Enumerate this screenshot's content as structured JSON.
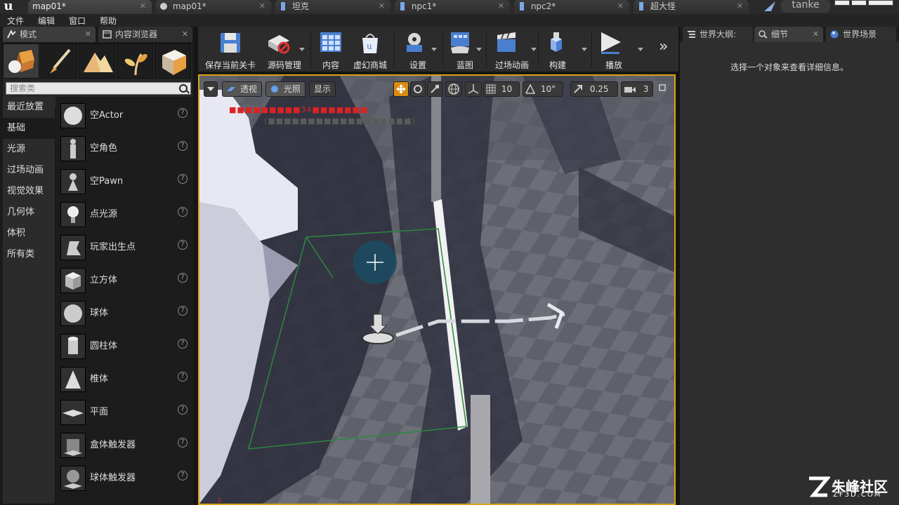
{
  "title_bar": {
    "tabs": [
      {
        "label": "map01*"
      },
      {
        "label": "map01*"
      },
      {
        "label": "坦克"
      },
      {
        "label": "npc1*"
      },
      {
        "label": "npc2*"
      },
      {
        "label": "超大怪"
      }
    ],
    "close_glyph": "✕",
    "project": "tanke"
  },
  "menu": {
    "items": [
      "文件",
      "编辑",
      "窗口",
      "帮助"
    ]
  },
  "left_panel": {
    "tabs": [
      {
        "label": "模式"
      },
      {
        "label": "内容浏览器"
      }
    ],
    "search_placeholder": "搜索类",
    "categories": [
      "最近放置",
      "基础",
      "光源",
      "过场动画",
      "视觉效果",
      "几何体",
      "体积",
      "所有类"
    ],
    "assets": [
      "空Actor",
      "空角色",
      "空Pawn",
      "点光源",
      "玩家出生点",
      "立方体",
      "球体",
      "圆柱体",
      "椎体",
      "平面",
      "盒体触发器",
      "球体触发器"
    ],
    "help_glyph": "?"
  },
  "toolbar": {
    "buttons": [
      "保存当前关卡",
      "源码管理",
      "内容",
      "虚幻商城",
      "设置",
      "蓝图",
      "过场动画",
      "构建",
      "播放"
    ],
    "more_glyph": "»"
  },
  "viewport": {
    "controls": {
      "perspective": "透视",
      "lit": "光照",
      "show": "显示"
    },
    "grid": "10",
    "rotation": "10°",
    "scale": "0.25",
    "camera_speed": "3",
    "stat_red": "■■■■■■■■■34■■■■■■■",
    "stat_gray": "(■■■■■■■■■■■■■■■■■■)"
  },
  "right_panel": {
    "tabs": [
      {
        "label": "世界大纲:"
      },
      {
        "label": "细节"
      },
      {
        "label": "世界场景"
      }
    ],
    "details_message": "选择一个对象来查看详细信息。"
  },
  "watermark": {
    "name": "朱峰社区",
    "domain": "ZF3D.COM"
  },
  "colors": {
    "viewport_border": "#d9a312",
    "accent_blue": "#4a7fd0"
  }
}
